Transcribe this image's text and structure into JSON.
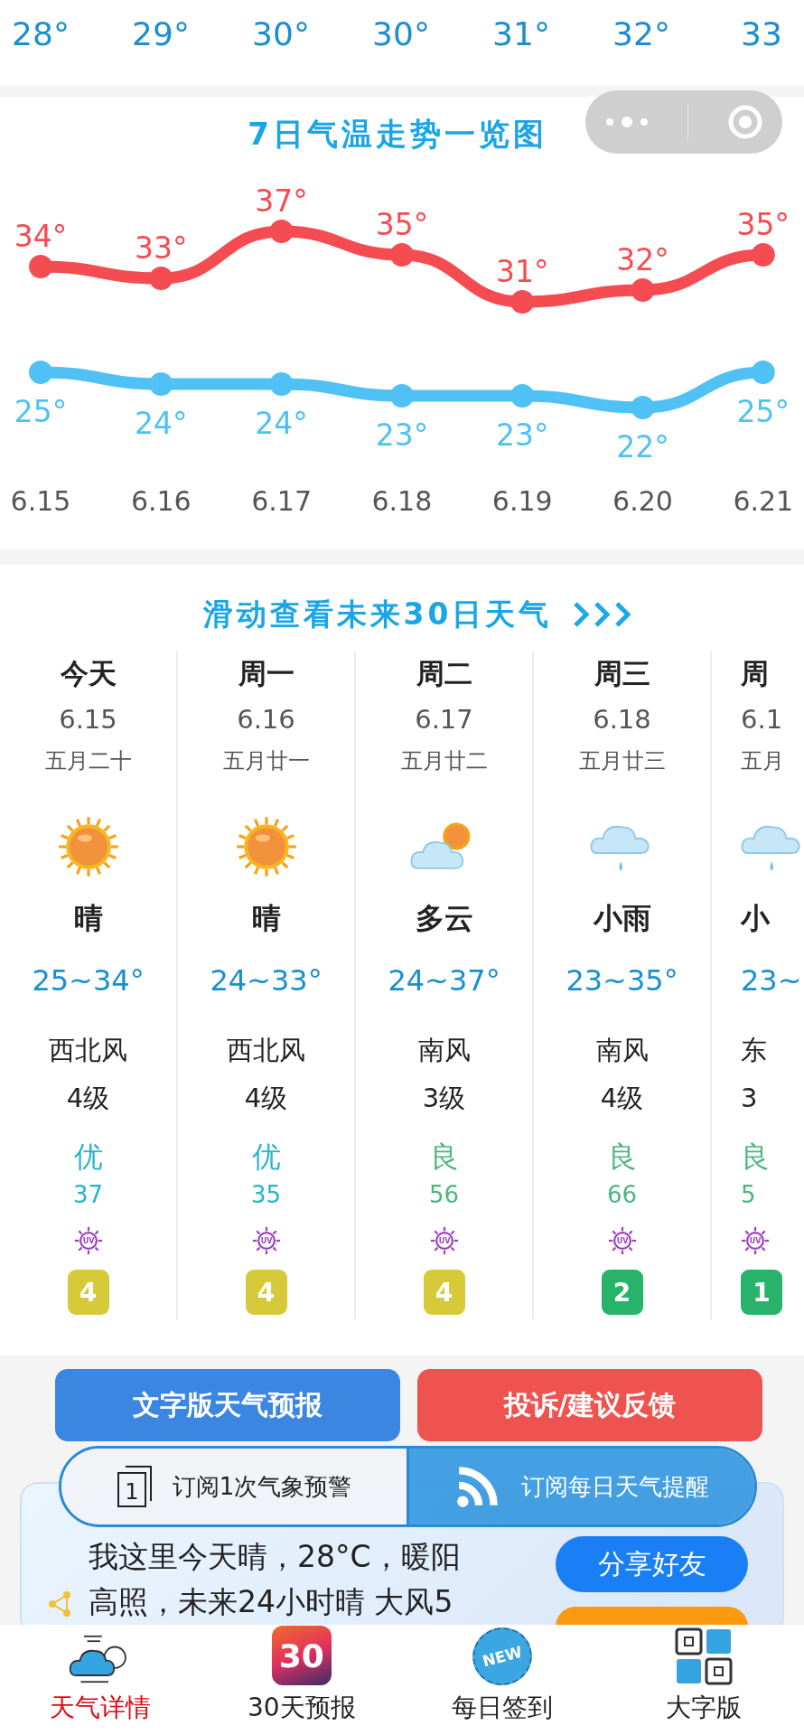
{
  "hourly_temps": [
    "28°",
    "29°",
    "30°",
    "30°",
    "31°",
    "32°",
    "33"
  ],
  "trend": {
    "title": "7日气温走势一览图",
    "chart_data": {
      "type": "line",
      "categories": [
        "6.15",
        "6.16",
        "6.17",
        "6.18",
        "6.19",
        "6.20",
        "6.21"
      ],
      "series": [
        {
          "color": "#f54c52",
          "marker": true,
          "values": [
            34,
            33,
            37,
            35,
            31,
            32,
            35
          ],
          "value_labels": [
            "34°",
            "33°",
            "37°",
            "35°",
            "31°",
            "32°",
            "35°"
          ]
        },
        {
          "color": "#4fc1f5",
          "marker": true,
          "values": [
            25,
            24,
            24,
            23,
            23,
            22,
            25
          ],
          "value_labels": [
            "25°",
            "24°",
            "24°",
            "23°",
            "23°",
            "22°",
            "25°"
          ]
        }
      ],
      "data_labels": true
    }
  },
  "forecast": {
    "title": "滑动查看未来30日天气",
    "days": [
      {
        "weekday": "今天",
        "date": "6.15",
        "lunar": "五月二十",
        "kind": "sunny",
        "condition": "晴",
        "range": "25~34°",
        "wind": "西北风",
        "wind_level": "4级",
        "aqi": {
          "label": "优",
          "value": "37",
          "color": "#27b6c9"
        },
        "uv": {
          "icon_label": "UV",
          "value": "4",
          "color": "#d6c93a"
        }
      },
      {
        "weekday": "周一",
        "date": "6.16",
        "lunar": "五月廿一",
        "kind": "sunny",
        "condition": "晴",
        "range": "24~33°",
        "wind": "西北风",
        "wind_level": "4级",
        "aqi": {
          "label": "优",
          "value": "35",
          "color": "#27b6c9"
        },
        "uv": {
          "icon_label": "UV",
          "value": "4",
          "color": "#d6c93a"
        }
      },
      {
        "weekday": "周二",
        "date": "6.17",
        "lunar": "五月廿二",
        "kind": "cloudy",
        "condition": "多云",
        "range": "24~37°",
        "wind": "南风",
        "wind_level": "3级",
        "aqi": {
          "label": "良",
          "value": "56",
          "color": "#4db67f"
        },
        "uv": {
          "icon_label": "UV",
          "value": "4",
          "color": "#d6c93a"
        }
      },
      {
        "weekday": "周三",
        "date": "6.18",
        "lunar": "五月廿三",
        "kind": "rain",
        "condition": "小雨",
        "range": "23~35°",
        "wind": "南风",
        "wind_level": "4级",
        "aqi": {
          "label": "良",
          "value": "66",
          "color": "#4db67f"
        },
        "uv": {
          "icon_label": "UV",
          "value": "2",
          "color": "#27b36a"
        }
      },
      {
        "weekday": "周",
        "date": "6.1",
        "lunar": "五月",
        "kind": "rain",
        "condition": "小",
        "range": "23~",
        "wind": "东",
        "wind_level": "3",
        "aqi": {
          "label": "良",
          "value": "5",
          "color": "#4db67f"
        },
        "uv": {
          "icon_label": "UV",
          "value": "1",
          "color": "#27b36a"
        }
      }
    ]
  },
  "actions": [
    {
      "label": "文字版天气预报",
      "color": "#3a86e0"
    },
    {
      "label": "投诉/建议反馈",
      "color": "#ef5350"
    }
  ],
  "subscriptions": [
    {
      "label": "订阅1次气象预警",
      "kind": "once",
      "icon_label": "1"
    },
    {
      "label": "订阅每日天气提醒",
      "kind": "daily"
    }
  ],
  "share": {
    "text": "我这里今天晴，28°C，暖阳高照，未来24小时晴 大风5",
    "button": "分享好友"
  },
  "tabs": [
    {
      "label": "天气详情",
      "kind": "weather",
      "selected": true
    },
    {
      "label": "30天预报",
      "kind": "month",
      "icon_label": "30",
      "selected": false
    },
    {
      "label": "每日签到",
      "kind": "checkin",
      "icon_label": "NEW",
      "selected": false
    },
    {
      "label": "大字版",
      "kind": "large",
      "selected": false
    }
  ]
}
